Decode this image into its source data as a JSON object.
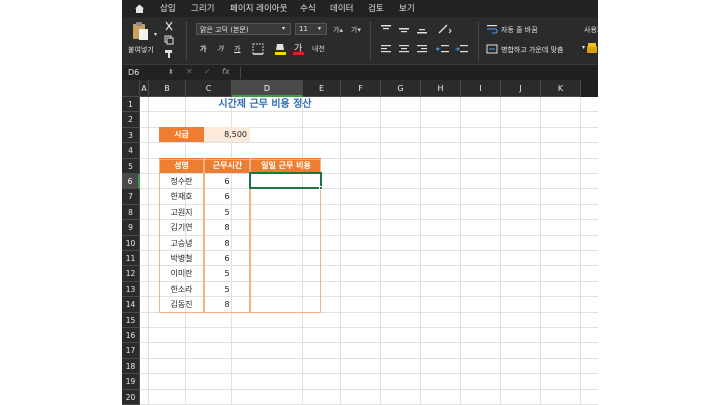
{
  "ribbon": {
    "tabs": [
      "삽입",
      "그리기",
      "페이지 레이아웃",
      "수식",
      "데이터",
      "검토",
      "보기"
    ],
    "paste_label": "붙여넣기",
    "font_name": "맑은 고딕 (본문)",
    "font_size": "11",
    "wrap_text_label": "자동 줄 바꿈",
    "merge_center_label": "병합하고 가운데 맞춤",
    "user_label": "사용자"
  },
  "formula_bar": {
    "name_box": "D6",
    "fx_label": "fx",
    "formula": ""
  },
  "columns": [
    "A",
    "B",
    "C",
    "D",
    "E",
    "F",
    "G",
    "H",
    "I",
    "J",
    "K"
  ],
  "selected_column": "D",
  "rows": [
    "1",
    "2",
    "3",
    "4",
    "5",
    "6",
    "7",
    "8",
    "9",
    "10",
    "11",
    "12",
    "13",
    "14",
    "15",
    "16",
    "17",
    "18",
    "19",
    "20"
  ],
  "selected_row": "6",
  "sheet": {
    "title": "시간제 근무 비용 정산",
    "rate_label": "시급",
    "rate_value": "8,500",
    "headers": [
      "성명",
      "근무시간",
      "일일 근무 비용"
    ],
    "employees": [
      {
        "name": "정수란",
        "hours": "6"
      },
      {
        "name": "한재호",
        "hours": "6"
      },
      {
        "name": "고원지",
        "hours": "5"
      },
      {
        "name": "김기연",
        "hours": "8"
      },
      {
        "name": "고승녕",
        "hours": "8"
      },
      {
        "name": "박병철",
        "hours": "6"
      },
      {
        "name": "이미란",
        "hours": "5"
      },
      {
        "name": "한소라",
        "hours": "5"
      },
      {
        "name": "김동진",
        "hours": "8"
      }
    ]
  },
  "colors": {
    "accent_orange": "#ed7d31",
    "title_blue": "#2f6db5",
    "selection_green": "#217346"
  }
}
